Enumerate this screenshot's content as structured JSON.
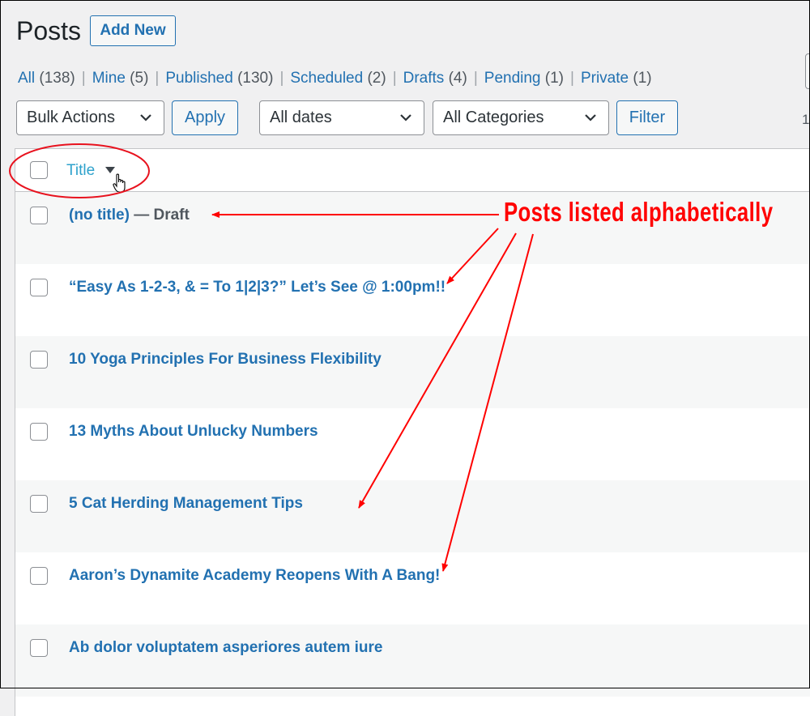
{
  "page": {
    "title": "Posts",
    "add_new_label": "Add New"
  },
  "views": [
    {
      "label": "All",
      "count": "(138)"
    },
    {
      "label": "Mine",
      "count": "(5)"
    },
    {
      "label": "Published",
      "count": "(130)"
    },
    {
      "label": "Scheduled",
      "count": "(2)"
    },
    {
      "label": "Drafts",
      "count": "(4)"
    },
    {
      "label": "Pending",
      "count": "(1)"
    },
    {
      "label": "Private",
      "count": "(1)"
    }
  ],
  "filters": {
    "bulk_actions": "Bulk Actions",
    "apply_label": "Apply",
    "dates": "All dates",
    "categories": "All Categories",
    "filter_label": "Filter",
    "pagination_partial": "1"
  },
  "table": {
    "title_column": "Title",
    "sort_icon": "sort-desc-icon",
    "rows": [
      {
        "title": "(no title)",
        "state": " — Draft"
      },
      {
        "title": "“Easy As 1-2-3, & = To 1|2|3?” Let’s See @ 1:00pm!!",
        "state": ""
      },
      {
        "title": "10 Yoga Principles For Business Flexibility",
        "state": ""
      },
      {
        "title": "13 Myths About Unlucky Numbers",
        "state": ""
      },
      {
        "title": "5 Cat Herding Management Tips",
        "state": ""
      },
      {
        "title": "Aaron’s Dynamite Academy Reopens With A Bang!",
        "state": ""
      },
      {
        "title": "Ab dolor voluptatem asperiores autem iure",
        "state": ""
      }
    ]
  },
  "annotation": {
    "label": "Posts listed alphabetically",
    "color": "#ff0000"
  },
  "colors": {
    "link": "#2271b1",
    "header_link": "#2ea2cc",
    "background": "#f0f0f1"
  }
}
